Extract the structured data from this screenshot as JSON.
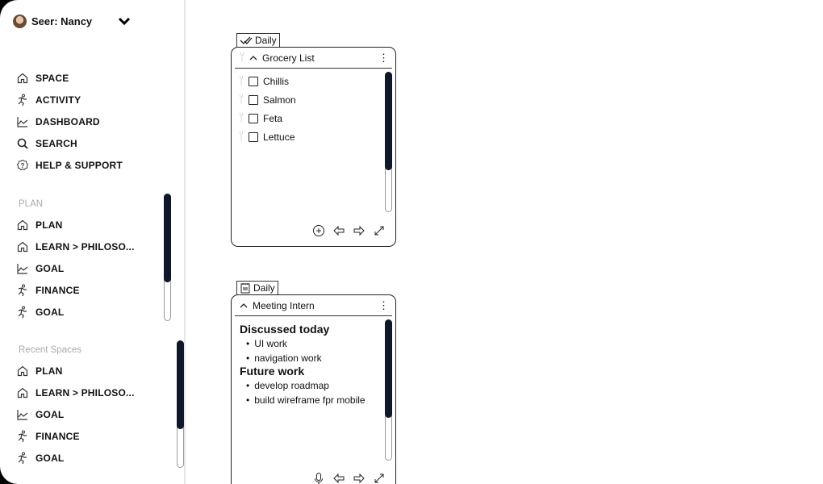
{
  "user": {
    "name": "Seer: Nancy"
  },
  "nav": [
    {
      "label": "SPACE",
      "icon": "home"
    },
    {
      "label": "ACTIVITY",
      "icon": "run"
    },
    {
      "label": "DASHBOARD",
      "icon": "chart"
    },
    {
      "label": "SEARCH",
      "icon": "search"
    },
    {
      "label": "HELP & SUPPORT",
      "icon": "help"
    }
  ],
  "plan": {
    "title": "PLAN",
    "items": [
      {
        "label": "PLAN",
        "icon": "home"
      },
      {
        "label": "LEARN > PHILOSO...",
        "icon": "home"
      },
      {
        "label": "GOAL",
        "icon": "chart"
      },
      {
        "label": "FINANCE",
        "icon": "run"
      },
      {
        "label": "GOAL",
        "icon": "run"
      }
    ]
  },
  "recent": {
    "title": "Recent Spaces",
    "items": [
      {
        "label": "PLAN",
        "icon": "home"
      },
      {
        "label": "LEARN > PHILOSO...",
        "icon": "home"
      },
      {
        "label": "GOAL",
        "icon": "chart"
      },
      {
        "label": "FINANCE",
        "icon": "run"
      },
      {
        "label": "GOAL",
        "icon": "run"
      }
    ]
  },
  "grocery": {
    "tab": "Daily",
    "title": "Grocery List",
    "items": [
      "Chillis",
      "Salmon",
      "Feta",
      "Lettuce"
    ]
  },
  "meeting": {
    "tab": "Daily",
    "title": "Meeting Intern",
    "h1": "Discussed today",
    "list1": [
      "UI work",
      "navigation work"
    ],
    "h2": "Future work",
    "list2": [
      "develop roadmap",
      "build wireframe fpr mobile"
    ]
  }
}
